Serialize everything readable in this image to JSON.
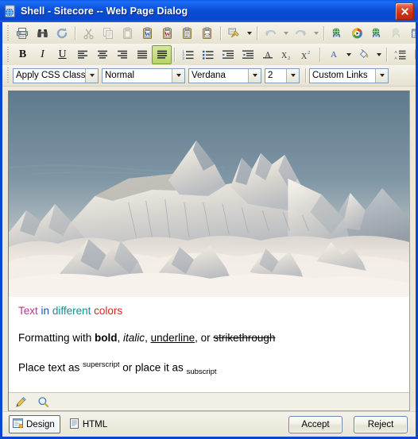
{
  "window": {
    "title": "Shell - Sitecore -- Web Page Dialog",
    "icon": "web-page-icon",
    "close_label": "✕",
    "titlebar_color": "#0a46d2",
    "client_color": "#ece9d8"
  },
  "toolbar_row1": {
    "items": [
      {
        "name": "print",
        "icon": "printer-icon",
        "type": "button",
        "enabled": true
      },
      {
        "name": "find",
        "icon": "binoculars-icon",
        "type": "button",
        "enabled": true
      },
      {
        "name": "refresh",
        "icon": "refresh-icon",
        "type": "button",
        "enabled": true
      },
      {
        "name": "separator-1",
        "type": "separator"
      },
      {
        "name": "cut",
        "icon": "scissors-icon",
        "type": "button",
        "enabled": false
      },
      {
        "name": "copy",
        "icon": "copy-icon",
        "type": "button",
        "enabled": false
      },
      {
        "name": "paste",
        "icon": "paste-icon",
        "type": "button",
        "enabled": false
      },
      {
        "name": "paste-from-word",
        "icon": "paste-word-icon",
        "type": "button",
        "enabled": true
      },
      {
        "name": "paste-from-word-strip-font",
        "icon": "paste-word-strip-icon",
        "type": "button",
        "enabled": true
      },
      {
        "name": "paste-plain-text",
        "icon": "paste-plain-icon",
        "type": "button",
        "enabled": true
      },
      {
        "name": "paste-as-html",
        "icon": "paste-html-icon",
        "type": "button",
        "enabled": true
      },
      {
        "name": "separator-2",
        "type": "separator"
      },
      {
        "name": "format-painter",
        "icon": "paintbrush-icon",
        "type": "button-split",
        "enabled": true
      },
      {
        "name": "separator-3",
        "type": "separator"
      },
      {
        "name": "undo",
        "icon": "undo-arrow-icon",
        "type": "button-split",
        "enabled": false
      },
      {
        "name": "redo",
        "icon": "redo-arrow-icon",
        "type": "button-split",
        "enabled": false
      },
      {
        "name": "separator-4",
        "type": "separator"
      },
      {
        "name": "insert-link",
        "icon": "globe-link-icon",
        "type": "button",
        "enabled": true
      },
      {
        "name": "insert-media",
        "icon": "media-play-icon",
        "type": "button",
        "enabled": true
      },
      {
        "name": "insert-anchor",
        "icon": "globe-anchor-icon",
        "type": "button",
        "enabled": true
      },
      {
        "name": "remove-link",
        "icon": "broken-link-icon",
        "type": "button",
        "enabled": false
      },
      {
        "name": "insert-table",
        "icon": "table-grid-icon",
        "type": "button-split",
        "enabled": true
      }
    ]
  },
  "toolbar_row2": {
    "items": [
      {
        "name": "bold",
        "icon": "bold-icon",
        "label": "B",
        "type": "text",
        "enabled": true
      },
      {
        "name": "italic",
        "icon": "italic-icon",
        "label": "I",
        "type": "text",
        "enabled": true
      },
      {
        "name": "underline",
        "icon": "underline-icon",
        "label": "U",
        "type": "text",
        "enabled": true
      },
      {
        "name": "align-left",
        "icon": "align-left-icon",
        "type": "button",
        "enabled": true
      },
      {
        "name": "align-center",
        "icon": "align-center-icon",
        "type": "button",
        "enabled": true
      },
      {
        "name": "align-right",
        "icon": "align-right-icon",
        "type": "button",
        "enabled": true
      },
      {
        "name": "align-justify",
        "icon": "align-justify-icon",
        "type": "button",
        "enabled": true
      },
      {
        "name": "align-justify-full",
        "icon": "align-justify-full-icon",
        "type": "button",
        "enabled": true,
        "active": true
      },
      {
        "name": "separator-1",
        "type": "separator"
      },
      {
        "name": "numbered-list",
        "icon": "ordered-list-icon",
        "type": "button",
        "enabled": true
      },
      {
        "name": "bulleted-list",
        "icon": "bulleted-list-icon",
        "type": "button",
        "enabled": true
      },
      {
        "name": "indent",
        "icon": "indent-icon",
        "type": "button",
        "enabled": true
      },
      {
        "name": "outdent",
        "icon": "outdent-icon",
        "type": "button",
        "enabled": true
      },
      {
        "name": "remove-formatting",
        "icon": "strip-formatting-icon",
        "type": "button",
        "enabled": true
      },
      {
        "name": "subscript",
        "icon": "subscript-icon",
        "label": "X₂",
        "type": "text",
        "enabled": true
      },
      {
        "name": "superscript",
        "icon": "superscript-icon",
        "label": "X²",
        "type": "text",
        "enabled": true
      },
      {
        "name": "separator-2",
        "type": "separator"
      },
      {
        "name": "font-color",
        "icon": "font-color-icon",
        "label": "A",
        "type": "text-split",
        "enabled": true
      },
      {
        "name": "highlight-color",
        "icon": "highlight-bucket-icon",
        "type": "button-split",
        "enabled": true
      },
      {
        "name": "separator-3",
        "type": "separator"
      },
      {
        "name": "paragraph-spacing",
        "icon": "line-spacing-icon",
        "type": "button",
        "enabled": true
      },
      {
        "name": "module-manager",
        "icon": "module-icon",
        "type": "button",
        "enabled": true
      }
    ]
  },
  "toolbar_row3": {
    "css_class": {
      "value": "Apply CSS Class",
      "name": "apply-css-class-select"
    },
    "paragraph_style": {
      "value": "Normal",
      "name": "paragraph-style-select"
    },
    "font_name": {
      "value": "Verdana",
      "name": "font-name-select"
    },
    "font_size": {
      "value": "2",
      "name": "font-size-select"
    },
    "custom_links": {
      "value": "Custom Links",
      "name": "custom-links-select"
    }
  },
  "editor": {
    "image": {
      "name": "mountain-photo",
      "alt": "Aerial photograph of snow-covered mountain range above a layer of clouds",
      "sky_color": "#6b8294",
      "snow_color": "#e9e6de",
      "cloud_color": "#efe9e1"
    },
    "paragraphs": {
      "colors_line": {
        "word1": "Text",
        "word2": "in",
        "word3": "different",
        "word4": "colors",
        "color1": "#cc2a8f",
        "color2": "#1f49c9",
        "color3": "#149090",
        "color4": "#e02020"
      },
      "formatting_line": {
        "prefix": "Formatting with ",
        "bold": "bold",
        "sep1": ", ",
        "italic": "italic",
        "sep2": ", ",
        "underline": "underline",
        "sep3": ", or ",
        "strikethrough": "strikethrough"
      },
      "script_line": {
        "prefix": "Place text as ",
        "superscript": "superscript",
        "middle": " or place it as ",
        "subscript": "subscript"
      }
    },
    "status_icons": [
      {
        "name": "edit-pencil-icon"
      },
      {
        "name": "zoom-magnifier-icon"
      }
    ]
  },
  "bottom_bar": {
    "tabs": [
      {
        "name": "design-tab",
        "label": "Design",
        "icon": "design-view-icon",
        "selected": true
      },
      {
        "name": "html-tab",
        "label": "HTML",
        "icon": "html-view-icon",
        "selected": false
      }
    ],
    "accept_label": "Accept",
    "reject_label": "Reject"
  }
}
